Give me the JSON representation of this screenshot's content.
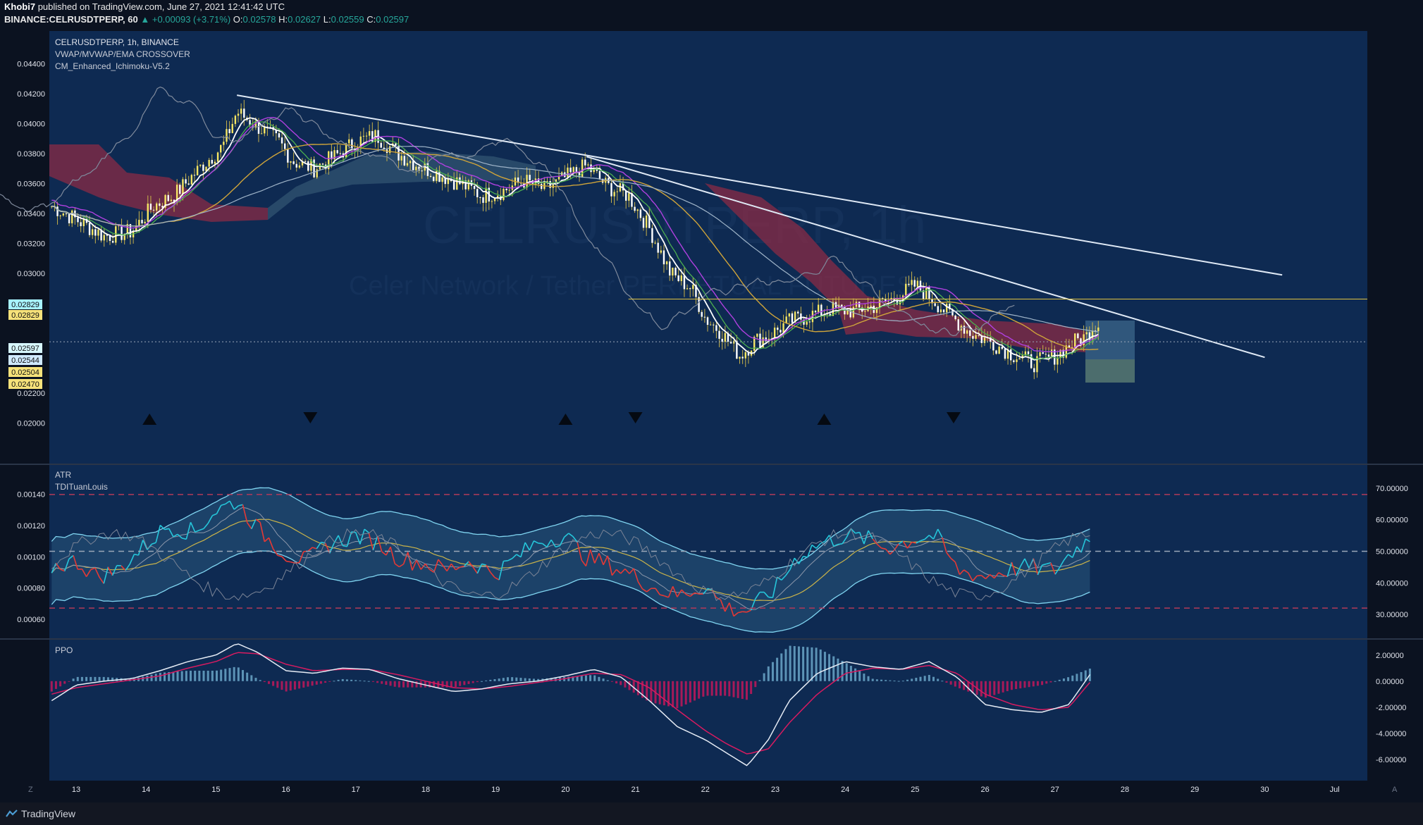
{
  "header": {
    "author": "Khobi7",
    "published_text": "published on TradingView.com, June 27, 2021 12:41:42 UTC",
    "symbol_line": "BINANCE:CELRUSDTPERP, 60",
    "change": "▲ +0.00093 (+3.71%)",
    "o_label": "O:",
    "o_value": "0.02578",
    "h_label": "H:",
    "h_value": "0.02627",
    "l_label": "L:",
    "l_value": "0.02559",
    "c_label": "C:",
    "c_value": "0.02597"
  },
  "legend": {
    "symbol": "CELRUSDTPERP, 1h, BINANCE",
    "ind1": "VWAP/MVWAP/EMA CROSSOVER",
    "ind2": "CM_Enhanced_Ichimoku-V5.2",
    "atr": "ATR",
    "tdi": "TDITuanLouis",
    "ppo": "PPO"
  },
  "watermark": {
    "big": "CELRUSDTPERP, 1h",
    "small": "Celer Network / Tether PERPETUAL FUTURES"
  },
  "footer": {
    "brand": "TradingView",
    "z_label": "Z",
    "a_label": "A"
  },
  "colors": {
    "bg": "#0b1220",
    "pane": "#0e2a52",
    "bull": "#f5e663",
    "bear": "#f5e663",
    "trend": "#dfe9f5",
    "cloud": "#8a2b45",
    "cloud_green": "#3a5f7a",
    "tdi_green": "#26c6da",
    "tdi_red": "#e53935"
  },
  "chart_data": [
    {
      "type": "line",
      "title": "CELRUSDTPERP, 1h, BINANCE",
      "x_ticks": [
        "13",
        "14",
        "15",
        "16",
        "17",
        "18",
        "19",
        "20",
        "21",
        "22",
        "23",
        "24",
        "25",
        "26",
        "27",
        "28",
        "29",
        "30",
        "Jul"
      ],
      "y_ticks": [
        "0.04400",
        "0.04200",
        "0.04000",
        "0.03800",
        "0.03600",
        "0.03400",
        "0.03200",
        "0.03000",
        "0.02200",
        "0.02000"
      ],
      "ylim": [
        0.0198,
        0.0452
      ],
      "grid": false,
      "price_labels": [
        "0.02829",
        "0.02829",
        "0.02597",
        "0.02544",
        "0.02504",
        "0.02470"
      ],
      "price_path_x_day": [
        12.65,
        13.0,
        13.4,
        13.8,
        14.1,
        14.4,
        14.8,
        15.1,
        15.3,
        15.6,
        15.9,
        16.1,
        16.4,
        16.7,
        17.0,
        17.3,
        17.6,
        17.9,
        18.2,
        18.5,
        18.8,
        19.1,
        19.4,
        19.7,
        20.0,
        20.3,
        20.6,
        20.9,
        21.2,
        21.5,
        21.8,
        22.0,
        22.2,
        22.5,
        22.7,
        22.9,
        23.2,
        23.5,
        23.8,
        24.1,
        24.4,
        24.7,
        25.0,
        25.2,
        25.5,
        25.8,
        26.1,
        26.4,
        26.7,
        27.0,
        27.3,
        27.45,
        27.55
      ],
      "price_path_close": [
        0.0345,
        0.0336,
        0.0325,
        0.0328,
        0.0345,
        0.0352,
        0.0372,
        0.0385,
        0.0408,
        0.0398,
        0.0388,
        0.0375,
        0.037,
        0.0378,
        0.0388,
        0.0392,
        0.038,
        0.0372,
        0.0366,
        0.036,
        0.0352,
        0.0355,
        0.0362,
        0.0356,
        0.0364,
        0.0372,
        0.0358,
        0.0352,
        0.033,
        0.03,
        0.029,
        0.027,
        0.0262,
        0.0245,
        0.0255,
        0.0258,
        0.0268,
        0.0272,
        0.0276,
        0.0275,
        0.0278,
        0.0283,
        0.0292,
        0.0285,
        0.0272,
        0.026,
        0.0254,
        0.0246,
        0.024,
        0.0245,
        0.0255,
        0.0258,
        0.0266
      ],
      "trendlines": [
        {
          "x": [
            15.3,
            30.25
          ],
          "y": [
            0.0419,
            0.0299
          ]
        },
        {
          "x": [
            20.3,
            30.0
          ],
          "y": [
            0.0378,
            0.0244
          ]
        }
      ],
      "horizontal_line": 0.02829,
      "dotted_line": 0.02544,
      "markers_up_x": [
        14.05,
        20.0,
        23.7
      ],
      "markers_down_x": [
        16.35,
        21.0,
        25.55
      ]
    },
    {
      "type": "line",
      "title": "ATR / TDITuanLouis",
      "y_ticks_left": [
        "0.00140",
        "0.00120",
        "0.00100",
        "0.00080",
        "0.00060"
      ],
      "y_ticks_right": [
        "70.00000",
        "60.00000",
        "50.00000",
        "40.00000",
        "30.00000"
      ],
      "ylim_left": [
        0.00055,
        0.00152
      ],
      "ylim_right": [
        26,
        74
      ],
      "levels": [
        68,
        50,
        32
      ],
      "rsi_x_day": [
        12.65,
        13.0,
        13.3,
        13.6,
        14.0,
        14.3,
        14.7,
        15.0,
        15.3,
        15.6,
        16.0,
        16.3,
        16.6,
        17.0,
        17.3,
        17.6,
        18.0,
        18.3,
        18.6,
        19.0,
        19.3,
        19.6,
        20.0,
        20.3,
        20.6,
        21.0,
        21.3,
        21.6,
        22.0,
        22.3,
        22.6,
        23.0,
        23.3,
        23.6,
        24.0,
        24.3,
        24.6,
        25.0,
        25.3,
        25.6,
        26.0,
        26.3,
        26.6,
        27.0,
        27.3,
        27.5
      ],
      "rsi": [
        45,
        47,
        42,
        44,
        52,
        58,
        56,
        63,
        66,
        57,
        49,
        47,
        52,
        55,
        53,
        48,
        46,
        44,
        47,
        43,
        48,
        53,
        55,
        48,
        46,
        42,
        38,
        36,
        39,
        32,
        31,
        38,
        48,
        52,
        55,
        54,
        51,
        54,
        55,
        44,
        42,
        44,
        45,
        44,
        51,
        54
      ]
    },
    {
      "type": "line",
      "title": "PPO",
      "y_ticks": [
        "2.00000",
        "0.00000",
        "-2.00000",
        "-4.00000",
        "-6.00000"
      ],
      "ylim": [
        -7.2,
        2.8
      ],
      "ppo_x_day": [
        12.65,
        13.0,
        13.4,
        13.8,
        14.2,
        14.6,
        15.0,
        15.3,
        15.6,
        16.0,
        16.4,
        16.8,
        17.2,
        17.6,
        18.0,
        18.4,
        18.8,
        19.2,
        19.6,
        20.0,
        20.4,
        20.8,
        21.2,
        21.6,
        22.0,
        22.3,
        22.6,
        22.9,
        23.2,
        23.6,
        24.0,
        24.4,
        24.8,
        25.2,
        25.6,
        26.0,
        26.4,
        26.8,
        27.2,
        27.5
      ],
      "ppo": [
        -1.5,
        -0.3,
        0.0,
        0.2,
        0.8,
        1.5,
        2.0,
        2.9,
        2.2,
        0.8,
        0.6,
        1.0,
        0.9,
        0.2,
        -0.3,
        -0.8,
        -0.6,
        -0.2,
        0.0,
        0.4,
        0.9,
        0.3,
        -1.5,
        -3.5,
        -4.5,
        -5.5,
        -6.5,
        -4.5,
        -1.5,
        0.6,
        1.5,
        1.1,
        0.9,
        1.5,
        0.3,
        -1.8,
        -2.2,
        -2.4,
        -1.8,
        0.5
      ],
      "signal": [
        -1.0,
        -0.5,
        -0.2,
        0.1,
        0.4,
        1.0,
        1.5,
        2.2,
        2.1,
        1.3,
        0.8,
        0.9,
        0.9,
        0.5,
        0.0,
        -0.5,
        -0.6,
        -0.4,
        -0.1,
        0.2,
        0.6,
        0.5,
        -0.5,
        -2.2,
        -3.8,
        -4.8,
        -5.6,
        -5.2,
        -3.2,
        -1.0,
        0.6,
        1.0,
        0.9,
        1.2,
        0.6,
        -1.0,
        -1.8,
        -2.2,
        -2.0,
        -0.1
      ]
    }
  ]
}
